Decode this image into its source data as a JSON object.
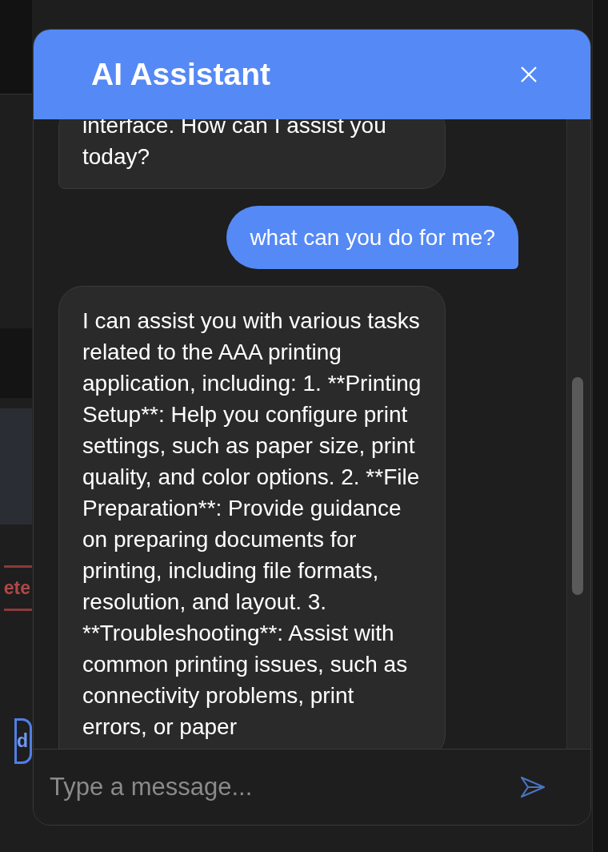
{
  "background": {
    "buttons": [
      {
        "label": "ete",
        "kind": "danger"
      },
      {
        "label": "d",
        "kind": "primary"
      }
    ]
  },
  "chat": {
    "title": "AI Assistant",
    "messages": [
      {
        "kind": "assistant",
        "text": "interface. How can I assist you today?"
      },
      {
        "kind": "user",
        "text": "what can you do for me?"
      },
      {
        "kind": "assistant",
        "text": "I can assist you with various tasks related to the AAA printing application, including: 1. **Printing Setup**: Help you configure print settings, such as paper size, print quality, and color options. 2. **File Preparation**: Provide guidance on preparing documents for printing, including file formats, resolution, and layout. 3. **Troubleshooting**: Assist with common printing issues, such as connectivity problems, print errors, or paper"
      }
    ],
    "input": {
      "placeholder": "Type a message..."
    }
  }
}
